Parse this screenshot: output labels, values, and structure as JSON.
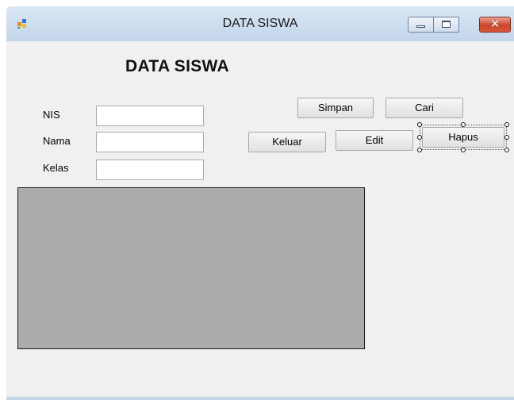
{
  "window": {
    "title": "DATA SISWA",
    "controls": {
      "minimize": "minimize-icon",
      "maximize": "maximize-icon",
      "close": "close-icon",
      "close_glyph": "✕"
    }
  },
  "form": {
    "heading": "DATA SISWA",
    "fields": [
      {
        "label": "NIS",
        "value": ""
      },
      {
        "label": "Nama",
        "value": ""
      },
      {
        "label": "Kelas",
        "value": ""
      }
    ],
    "buttons": {
      "simpan": "Simpan",
      "cari": "Cari",
      "keluar": "Keluar",
      "edit": "Edit",
      "hapus": "Hapus"
    },
    "data_grid": {
      "rows": []
    }
  },
  "colors": {
    "title_bar": "#c5d6ea",
    "form_background": "#f0f0f0",
    "grid_background": "#ababab",
    "close_button": "#c8452a"
  }
}
